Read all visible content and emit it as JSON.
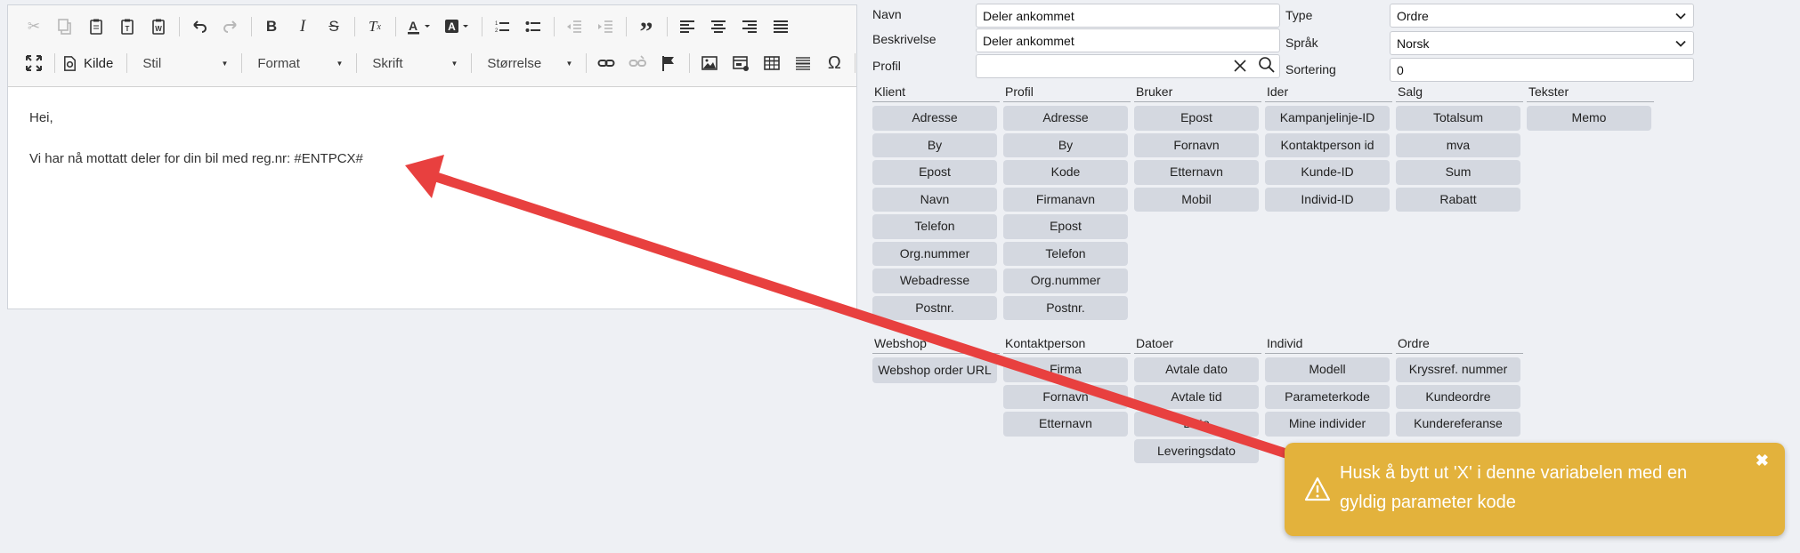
{
  "toolbar": {
    "source_label": "Kilde",
    "style_combo": "Stil",
    "format_combo": "Format",
    "font_combo": "Skrift",
    "size_combo": "Størrelse"
  },
  "editor": {
    "line1": "Hei,",
    "line2": "Vi har nå mottatt deler for din bil med reg.nr: #ENTPCX#"
  },
  "form": {
    "name_label": "Navn",
    "name_value": "Deler ankommet",
    "desc_label": "Beskrivelse",
    "desc_value": "Deler ankommet",
    "profile_label": "Profil",
    "profile_value": "",
    "type_label": "Type",
    "type_value": "Ordre",
    "lang_label": "Språk",
    "lang_value": "Norsk",
    "sort_label": "Sortering",
    "sort_value": "0"
  },
  "groups_top": [
    {
      "title": "Klient",
      "items": [
        "Adresse",
        "By",
        "Epost",
        "Navn",
        "Telefon",
        "Org.nummer",
        "Webadresse",
        "Postnr."
      ]
    },
    {
      "title": "Profil",
      "items": [
        "Adresse",
        "By",
        "Kode",
        "Firmanavn",
        "Epost",
        "Telefon",
        "Org.nummer",
        "Postnr."
      ]
    },
    {
      "title": "Bruker",
      "items": [
        "Epost",
        "Fornavn",
        "Etternavn",
        "Mobil"
      ]
    },
    {
      "title": "Ider",
      "items": [
        "Kampanjelinje-ID",
        "Kontaktperson id",
        "Kunde-ID",
        "Individ-ID"
      ]
    },
    {
      "title": "Salg",
      "items": [
        "Totalsum",
        "mva",
        "Sum",
        "Rabatt"
      ]
    },
    {
      "title": "Tekster",
      "items": [
        "Memo"
      ]
    }
  ],
  "groups_bottom": [
    {
      "title": "Webshop",
      "items": [
        "Webshop order URL"
      ]
    },
    {
      "title": "Kontaktperson",
      "items": [
        "Firma",
        "Fornavn",
        "Etternavn"
      ]
    },
    {
      "title": "Datoer",
      "items": [
        "Avtale dato",
        "Avtale tid",
        "Dato",
        "Leveringsdato"
      ]
    },
    {
      "title": "Individ",
      "items": [
        "Modell",
        "Parameterkode",
        "Mine individer"
      ]
    },
    {
      "title": "Ordre",
      "items": [
        "Kryssref. nummer",
        "Kundeordre",
        "Kundereferanse"
      ]
    }
  ],
  "toast": {
    "message": "Husk å bytt ut 'X' i denne variabelen med en gyldig parameter kode",
    "color": "#e3b23c"
  },
  "colors": {
    "annotation_arrow": "#e8403f",
    "chip_bg": "#d4d8e0"
  }
}
